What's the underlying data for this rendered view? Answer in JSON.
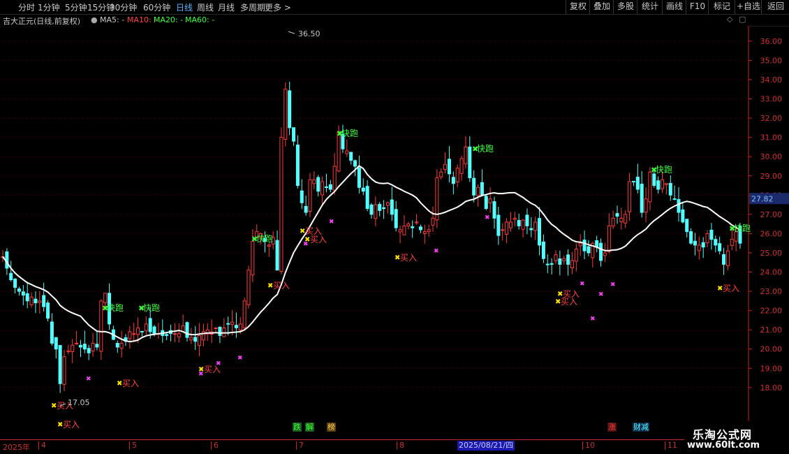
{
  "toolbar": {
    "periods": [
      "分时",
      "1分钟",
      "5分钟",
      "15分钟",
      "30分钟",
      "60分钟",
      "日线",
      "周线",
      "月线",
      "多周期",
      "更多 >"
    ],
    "active_period": "日线",
    "right_buttons": [
      "复权",
      "叠加",
      "多股",
      "统计",
      "画线",
      "F10",
      "标记",
      "+自选",
      "返回"
    ]
  },
  "info": {
    "stock_title": "吉大正元(日线,前复权)",
    "ma5": "MA5: -",
    "ma10": "MA10: -",
    "ma20": "MA20: -",
    "ma60": "MA60: -"
  },
  "price_label": "27.82",
  "annotations": {
    "high_label": "36.50",
    "low_label": "17.05",
    "run_label": "快跑",
    "buy_label": "买入"
  },
  "timeline": {
    "year": "2025年",
    "months": [
      "4",
      "5",
      "6",
      "7",
      "8",
      "9",
      "10",
      "11"
    ],
    "highlight_date": "2025/08/21/四",
    "event_markers": [
      "跌",
      "解",
      "榜",
      "涨",
      "财减"
    ]
  },
  "watermark": {
    "line1": "乐淘公式网",
    "line2": "www.60lt.com"
  },
  "colors": {
    "up": "#ff3b3b",
    "down": "#54ffff",
    "ma": "#ffffff",
    "axis": "#cc2020",
    "run": "#3cff3c",
    "buy": "#ffe400",
    "active": "#5ab4ff"
  },
  "chart_data": {
    "type": "candlestick",
    "y_range": [
      17.5,
      37.0
    ],
    "y_ticks": [
      18.0,
      19.0,
      20.0,
      21.0,
      22.0,
      23.0,
      24.0,
      25.0,
      26.0,
      27.0,
      28.0,
      29.0,
      30.0,
      31.0,
      32.0,
      33.0,
      34.0,
      35.0,
      36.0
    ],
    "last_price": 27.82,
    "high": 36.5,
    "low": 17.05,
    "closes": [
      24.8,
      24.2,
      23.6,
      23.2,
      23.0,
      22.8,
      22.5,
      22.7,
      22.4,
      22.5,
      22.2,
      21.6,
      20.3,
      20.0,
      18.2,
      19.6,
      19.9,
      20.2,
      20.3,
      20.1,
      20.0,
      19.8,
      20.3,
      20.1,
      22.5,
      22.9,
      21.3,
      20.5,
      20.1,
      20.3,
      20.4,
      20.9,
      20.8,
      21.1,
      20.9,
      21.3,
      20.9,
      20.8,
      20.8,
      20.7,
      20.7,
      20.8,
      20.8,
      20.8,
      21.2,
      20.6,
      20.6,
      20.4,
      20.7,
      20.9,
      21.0,
      20.9,
      21.1,
      20.7,
      21.1,
      21.3,
      21.4,
      21.1,
      21.3,
      22.5,
      24.1,
      25.6,
      26.1,
      26.0,
      25.6,
      25.4,
      25.8,
      24.1,
      31.0,
      33.5,
      31.5,
      30.8,
      28.5,
      27.6,
      27.1,
      28.8,
      28.8,
      28.2,
      28.7,
      28.4,
      28.3,
      29.5,
      31.3,
      30.4,
      30.3,
      29.8,
      29.5,
      28.4,
      28.2,
      27.3,
      27.0,
      27.5,
      27.2,
      27.3,
      27.6,
      27.0,
      26.3,
      26.2,
      26.4,
      26.5,
      26.3,
      26.6,
      26.2,
      26.1,
      26.2,
      26.8,
      28.9,
      29.2,
      29.6,
      29.1,
      28.6,
      29.4,
      29.9,
      30.5,
      28.9,
      28.0,
      28.4,
      28.0,
      27.3,
      27.8,
      26.8,
      25.9,
      26.2,
      26.6,
      26.6,
      26.8,
      26.4,
      26.7,
      26.4,
      26.2,
      26.6,
      25.4,
      24.7,
      24.4,
      24.4,
      24.9,
      24.4,
      24.7,
      24.4,
      24.6,
      25.2,
      25.5,
      25.1,
      25.0,
      25.5,
      25.3,
      24.6,
      25.0,
      26.4,
      26.8,
      26.9,
      26.8,
      27.0,
      28.7,
      28.7,
      28.3,
      27.1,
      27.8,
      29.2,
      28.5,
      28.3,
      28.8,
      28.6,
      28.0,
      27.8,
      27.1,
      26.6,
      26.1,
      25.5,
      25.4,
      25.4,
      25.3,
      26.0,
      25.7,
      25.4,
      25.1,
      24.4,
      25.1,
      25.7,
      26.1,
      25.5
    ]
  }
}
